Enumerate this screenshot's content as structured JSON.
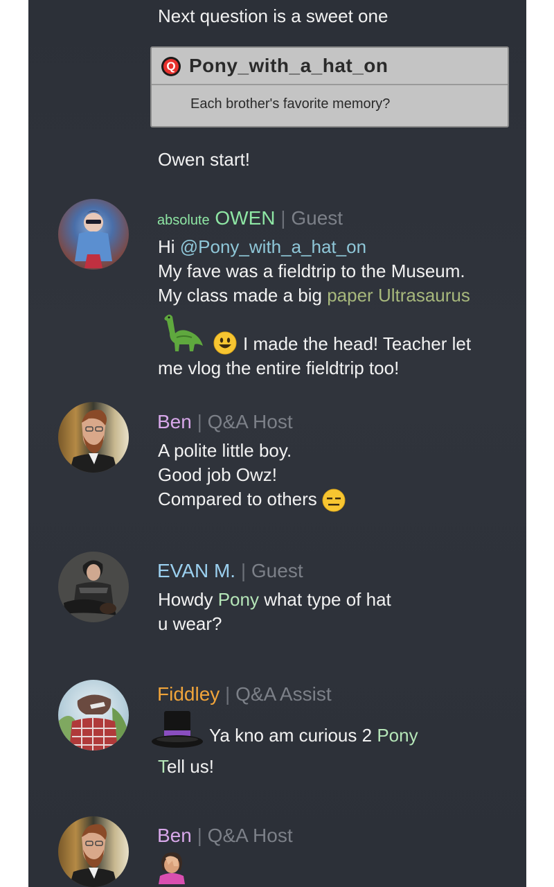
{
  "top": {
    "intro": "Next question is a sweet one",
    "question_card": {
      "badge_letter": "Q",
      "asker": "Pony_with_a_hat_on",
      "question": "Each brother's favorite memory?"
    },
    "start_line": "Owen start!"
  },
  "messages": [
    {
      "prefix": "absolute",
      "name": "OWEN",
      "separator": "|",
      "role": "Guest",
      "name_color": "#8ee6a4",
      "lines": {
        "l1_a": "Hi ",
        "l1_mention": "@Pony_with_a_hat_on",
        "l2": "My fave was a fieldtrip to the Museum.",
        "l3_a": "My class made a big ",
        "l3_highlight": "paper Ultrasaurus",
        "l4": "I made the head! Teacher let",
        "l5": "me vlog the entire fieldtrip too!"
      },
      "icons": [
        "sauropod-emoji",
        "smiley-emoji"
      ]
    },
    {
      "name": "Ben",
      "separator": "|",
      "role": "Q&A Host",
      "name_color": "#d8a8ea",
      "lines": {
        "l1": "A polite little boy.",
        "l2": "Good job Owz!",
        "l3": "Compared to others"
      },
      "icons": [
        "expressionless-emoji"
      ]
    },
    {
      "name": "EVAN M.",
      "separator": "|",
      "role": "Guest",
      "name_color": "#9bd0ef",
      "lines": {
        "l1_a": "Howdy ",
        "l1_highlight": "Pony",
        "l1_b": " what type of hat",
        "l2": "u wear?"
      }
    },
    {
      "name": "Fiddley",
      "separator": "|",
      "role": "Q&A Assist",
      "name_color": "#f0a43a",
      "lines": {
        "l1_a": "Ya kno am curious 2 ",
        "l1_highlight": "Pony",
        "l2_first": "T",
        "l2_rest": "ell us!"
      },
      "icons": [
        "top-hat-emoji"
      ]
    },
    {
      "name": "Ben",
      "separator": "|",
      "role": "Q&A Host",
      "name_color": "#d8a8ea",
      "icons": [
        "facepalm-emoji"
      ]
    }
  ],
  "colors": {
    "mention": "#8fc7d8",
    "highlight_green": "#b5e6b8",
    "highlight_olive": "#a7b87c",
    "role_gray": "#7c8088"
  }
}
